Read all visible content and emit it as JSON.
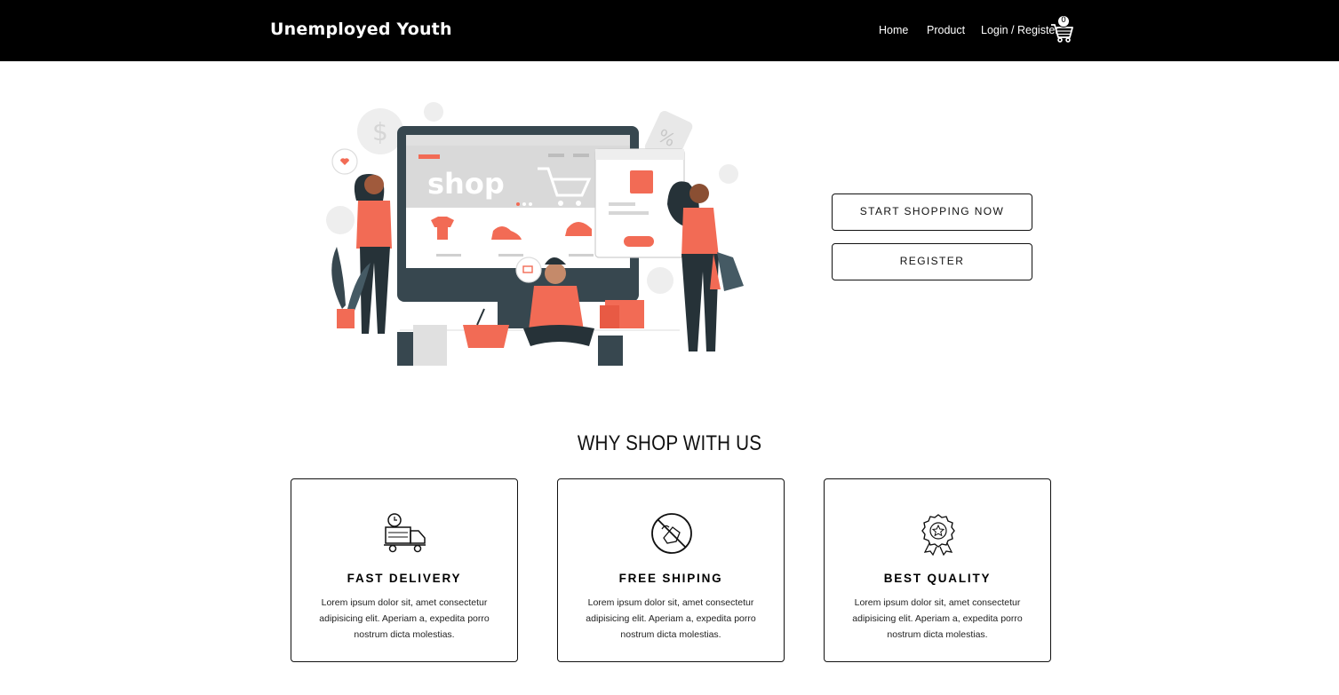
{
  "brand": "Unemployed Youth",
  "nav": {
    "home": "Home",
    "product": "Product",
    "login": "Login / Register",
    "cart_count": "0"
  },
  "hero": {
    "illustration_text": "shop",
    "start_button": "START SHOPPING NOW",
    "register_button": "REGISTER"
  },
  "why": {
    "title": "WHY SHOP WITH US",
    "cards": [
      {
        "icon": "delivery-truck-icon",
        "title": "FAST DELIVERY",
        "text": "Lorem ipsum dolor sit, amet consectetur adipisicing elit. Aperiam a, expedita porro nostrum dicta molestias."
      },
      {
        "icon": "no-shipping-fee-icon",
        "title": "FREE SHIPING",
        "text": "Lorem ipsum dolor sit, amet consectetur adipisicing elit. Aperiam a, expedita porro nostrum dicta molestias."
      },
      {
        "icon": "quality-badge-icon",
        "title": "BEST QUALITY",
        "text": "Lorem ipsum dolor sit, amet consectetur adipisicing elit. Aperiam a, expedita porro nostrum dicta molestias."
      }
    ]
  },
  "colors": {
    "nav_bg": "#000000",
    "accent": "#f26b55",
    "dark": "#37474f"
  }
}
